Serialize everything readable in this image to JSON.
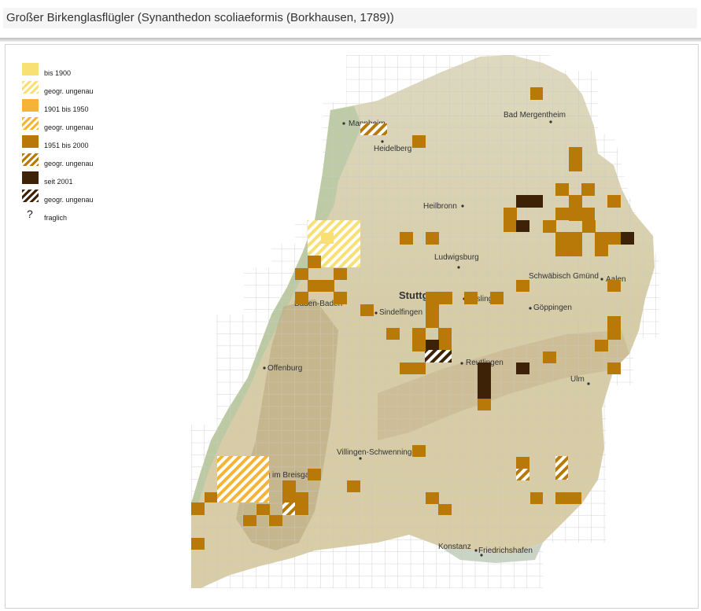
{
  "header": {
    "title": "Großer Birkenglasflügler  (Synanthedon scoliaeformis (Borkhausen, 1789))"
  },
  "legend": {
    "items": [
      {
        "label": "bis 1900",
        "color": "#f8e074",
        "hatched": false
      },
      {
        "label": "geogr. ungenau",
        "color": "#f8e074",
        "hatched": true
      },
      {
        "label": "1901 bis 1950",
        "color": "#f6b336",
        "hatched": false
      },
      {
        "label": "geogr. ungenau",
        "color": "#f6b336",
        "hatched": true
      },
      {
        "label": "1951 bis 2000",
        "color": "#b87908",
        "hatched": false
      },
      {
        "label": "geogr. ungenau",
        "color": "#b87908",
        "hatched": true
      },
      {
        "label": "seit 2001",
        "color": "#3d2207",
        "hatched": false
      },
      {
        "label": "geogr. ungenau",
        "color": "#3d2207",
        "hatched": true
      },
      {
        "label": "fraglich",
        "symbol": "?"
      }
    ]
  },
  "map": {
    "region": "Baden-Württemberg",
    "places": [
      "Mannheim",
      "Heidelberg",
      "Bad Mergentheim",
      "Heilbronn",
      "Ludwigsburg",
      "Stuttgart",
      "Esslingen",
      "Schwäbisch Gmünd",
      "Aalen",
      "Göppingen",
      "Sindelfingen",
      "Baden-Baden",
      "Offenburg",
      "Reutlingen",
      "Ulm",
      "Villingen-Schwenningen",
      "Freiburg im Breisgau",
      "Konstanz",
      "Friedrichshafen"
    ]
  }
}
